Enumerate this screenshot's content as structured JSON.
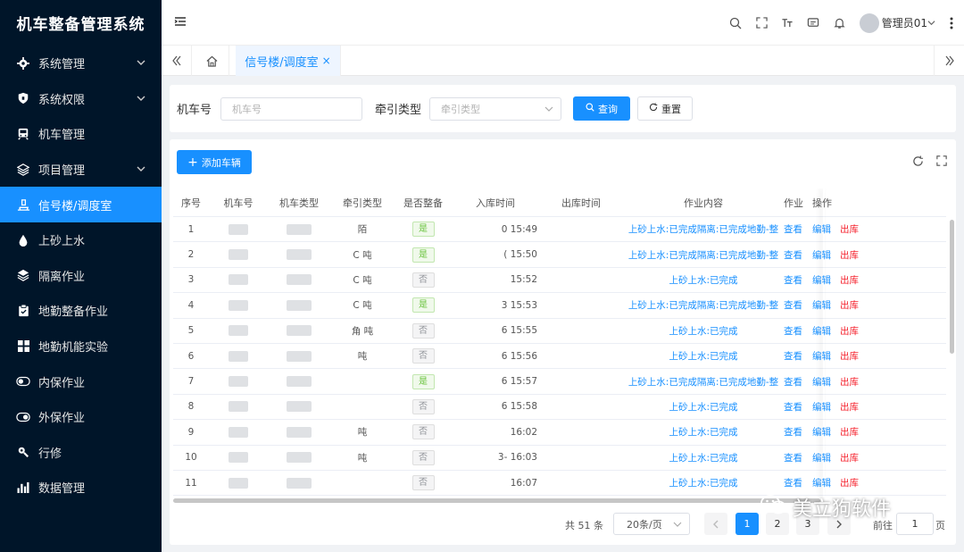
{
  "app": {
    "title": "机车整备管理系统"
  },
  "sidebar": {
    "items": [
      {
        "label": "系统管理",
        "icon": "gear-icon",
        "has_children": true
      },
      {
        "label": "系统权限",
        "icon": "shield-icon",
        "has_children": true
      },
      {
        "label": "机车管理",
        "icon": "train-icon",
        "has_children": false
      },
      {
        "label": "项目管理",
        "icon": "layers-icon",
        "has_children": true
      },
      {
        "label": "信号楼/调度室",
        "icon": "dispatch-icon",
        "has_children": false,
        "active": true
      },
      {
        "label": "上砂上水",
        "icon": "drop-icon",
        "has_children": false
      },
      {
        "label": "隔离作业",
        "icon": "layers-icon",
        "has_children": false
      },
      {
        "label": "地勤整备作业",
        "icon": "clipboard-icon",
        "has_children": false
      },
      {
        "label": "地勤机能实验",
        "icon": "grid-icon",
        "has_children": false
      },
      {
        "label": "内保作业",
        "icon": "toggle-icon",
        "has_children": false
      },
      {
        "label": "外保作业",
        "icon": "toggle-icon",
        "has_children": false
      },
      {
        "label": "行修",
        "icon": "wrench-icon",
        "has_children": false
      },
      {
        "label": "数据管理",
        "icon": "bar-chart-icon",
        "has_children": false
      }
    ]
  },
  "header": {
    "user": "管理员01",
    "icons": [
      "search-icon",
      "fullscreen-icon",
      "font-size-icon",
      "message-icon",
      "bell-icon"
    ]
  },
  "tabs": [
    {
      "label": "信号楼/调度室",
      "active": true
    }
  ],
  "search": {
    "loco_label": "机车号",
    "loco_placeholder": "机车号",
    "trac_label": "牵引类型",
    "trac_placeholder": "牵引类型",
    "query_label": "查询",
    "reset_label": "重置"
  },
  "toolbar": {
    "add_label": "添加车辆"
  },
  "table": {
    "columns": [
      "序号",
      "机车号",
      "机车类型",
      "牵引类型",
      "是否整备",
      "入库时间",
      "出库时间",
      "作业内容",
      "作业",
      "操作"
    ],
    "rows": [
      {
        "no": "1",
        "trac": "陌",
        "ready": "是",
        "in": "0 15:49",
        "work": "上砂上水:已完成隔离:已完成地勤-整",
        "view": "查看"
      },
      {
        "no": "2",
        "trac": "C 吨",
        "ready": "是",
        "in": "( 15:50",
        "work": "上砂上水:已完成隔离:已完成地勤-整",
        "view": "查看"
      },
      {
        "no": "3",
        "trac": "C 吨",
        "ready": "否",
        "in": "15:52",
        "work": "上砂上水:已完成",
        "view": "查看"
      },
      {
        "no": "4",
        "trac": "C 吨",
        "ready": "是",
        "in": "3 15:53",
        "work": "上砂上水:已完成隔离:已完成地勤-整",
        "view": "查看"
      },
      {
        "no": "5",
        "trac": "角 吨",
        "ready": "否",
        "in": "6 15:55",
        "work": "上砂上水:已完成",
        "view": "查看"
      },
      {
        "no": "6",
        "trac": "吨",
        "ready": "否",
        "in": "6 15:56",
        "work": "上砂上水:已完成",
        "view": "查看"
      },
      {
        "no": "7",
        "trac": "",
        "ready": "是",
        "in": "6 15:57",
        "work": "上砂上水:已完成隔离:已完成地勤-整",
        "view": "查看"
      },
      {
        "no": "8",
        "trac": "",
        "ready": "否",
        "in": "6 15:58",
        "work": "上砂上水:已完成",
        "view": "查看"
      },
      {
        "no": "9",
        "trac": "吨",
        "ready": "否",
        "in": "16:02",
        "work": "上砂上水:已完成",
        "view": "查看"
      },
      {
        "no": "10",
        "trac": "吨",
        "ready": "否",
        "in": "3- 16:03",
        "work": "上砂上水:已完成",
        "view": "查看"
      },
      {
        "no": "11",
        "trac": "",
        "ready": "否",
        "in": "16:07",
        "work": "上砂上水:已完成",
        "view": "查看"
      }
    ],
    "op_edit": "编辑",
    "op_out": "出库"
  },
  "pagination": {
    "total": "共 51 条",
    "page_size": "20条/页",
    "pages": [
      "1",
      "2",
      "3"
    ],
    "current": "1",
    "goto_label": "前往",
    "goto_value": "1",
    "page_suffix": "页"
  },
  "watermark": {
    "text": "美立狗软件"
  }
}
